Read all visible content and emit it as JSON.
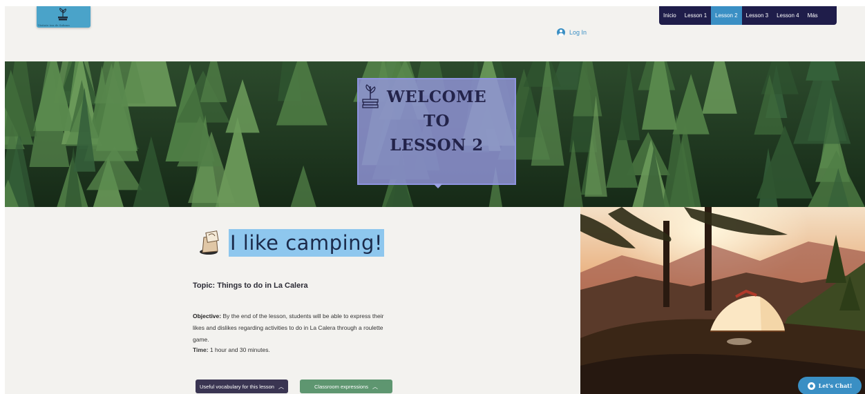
{
  "header": {
    "logo_text": "Visitate tan de Sabana",
    "login_label": "Log In"
  },
  "nav": {
    "items": [
      {
        "label": "Inicio"
      },
      {
        "label": "Lesson 1"
      },
      {
        "label": "Lesson 2",
        "active": true
      },
      {
        "label": "Lesson 3"
      },
      {
        "label": "Lesson 4"
      },
      {
        "label": "Más"
      }
    ]
  },
  "banner": {
    "lines": [
      "WELCOME",
      "TO",
      "LESSON 2"
    ]
  },
  "lesson": {
    "title": "I like camping!",
    "topic": "Topic: Things to do in La Calera",
    "objective_label": "Objective:",
    "objective_text": " By the end of the lesson, students will be able to express their likes and dislikes regarding activities to do in La Calera through a roulette game.",
    "time_label": "Time:",
    "time_text": " 1 hour and 30 minutes."
  },
  "buttons": {
    "vocab": "Useful vocabulary for this lesson",
    "classroom": "Classroom expressions"
  },
  "chat": {
    "label": "Let's Chat!"
  },
  "colors": {
    "nav_bg": "#1f1d4a",
    "nav_active": "#3a8fc4",
    "title_highlight": "#8ec7ee",
    "vocab_button": "#3a3552",
    "classroom_button": "#5e9670"
  }
}
